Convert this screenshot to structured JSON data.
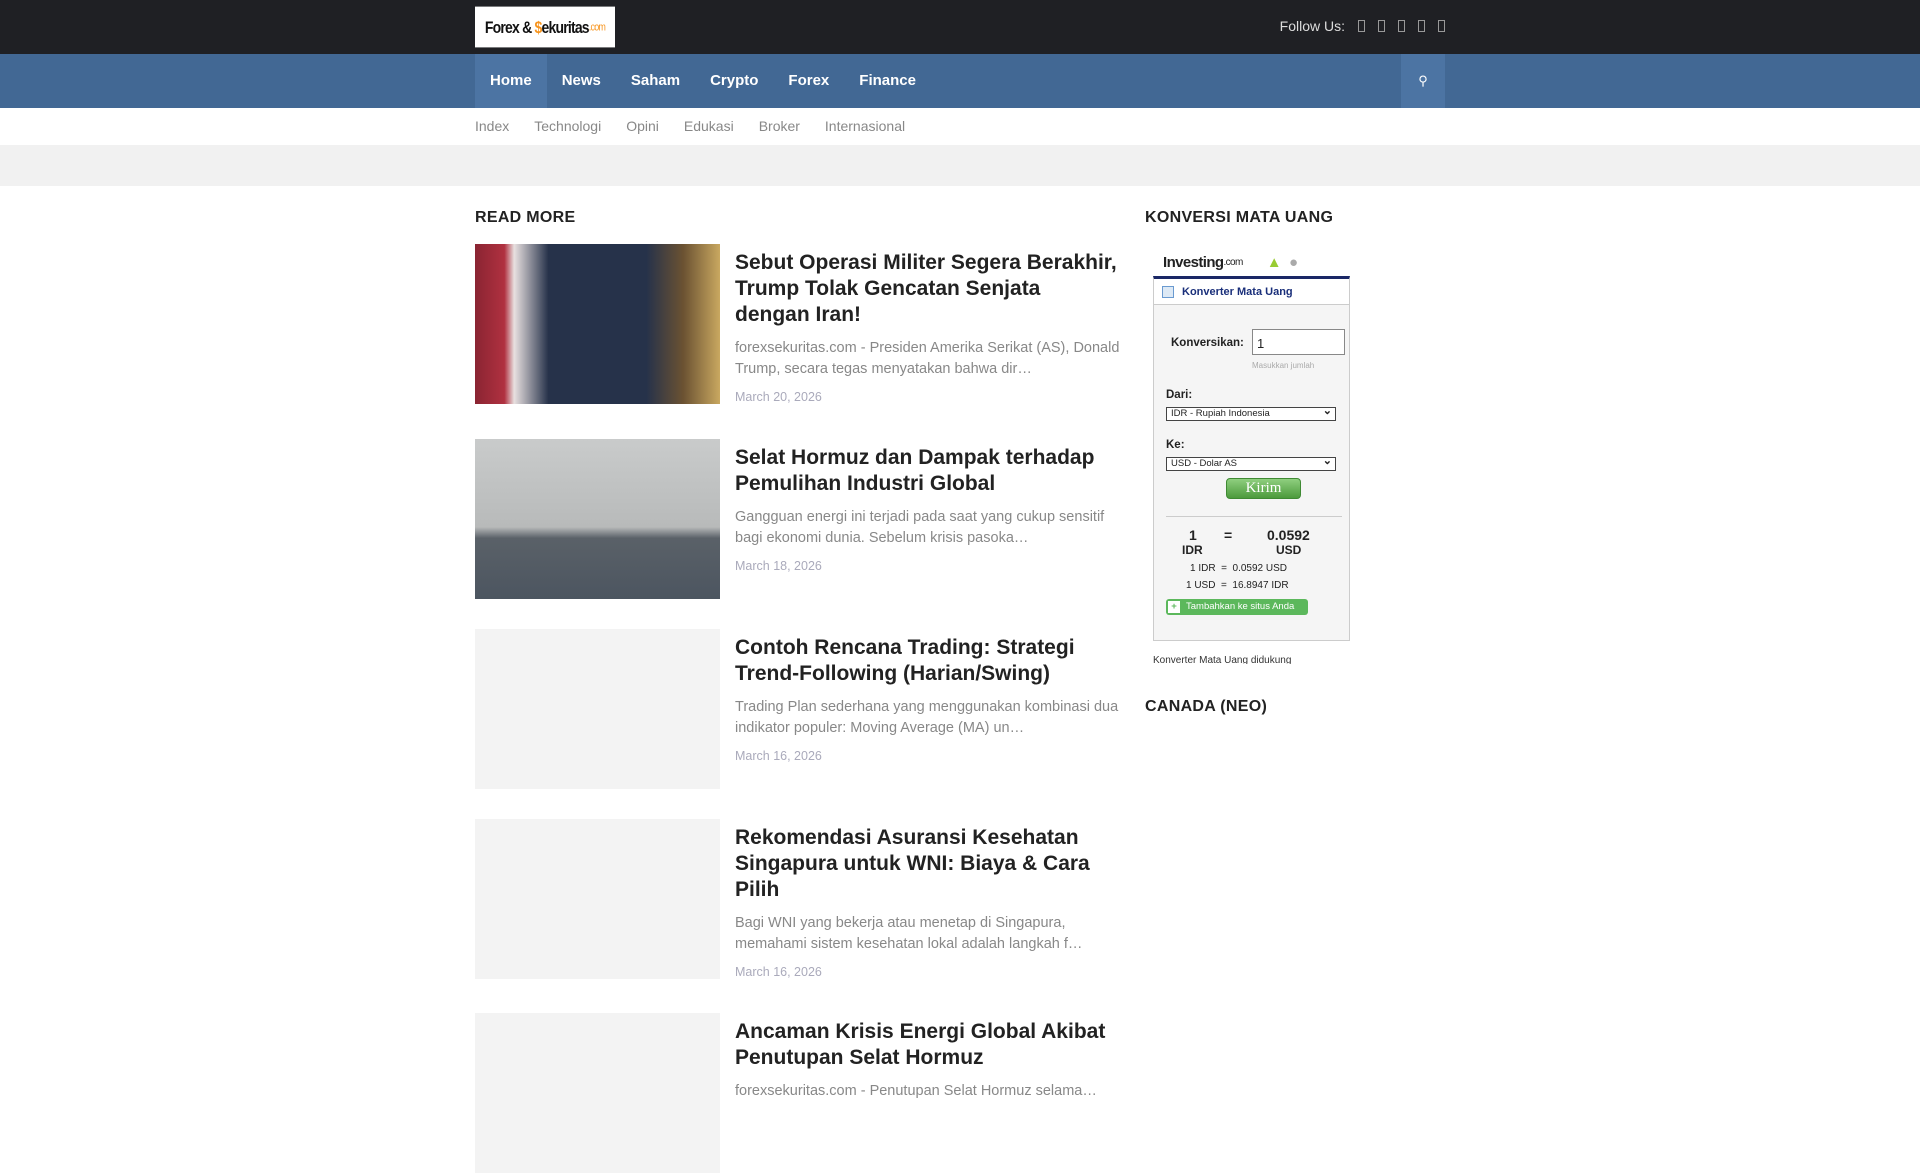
{
  "header": {
    "logo_text": "Forex & Sekuritas.com",
    "follow_label": "Follow Us:"
  },
  "nav": {
    "items": [
      "Home",
      "News",
      "Saham",
      "Crypto",
      "Forex",
      "Finance"
    ]
  },
  "subnav": {
    "items": [
      "Index",
      "Technologi",
      "Opini",
      "Edukasi",
      "Broker",
      "Internasional"
    ]
  },
  "main": {
    "heading": "READ MORE",
    "articles": [
      {
        "title": "Sebut Operasi Militer Segera Berakhir, Trump Tolak Gencatan Senjata dengan Iran!",
        "excerpt": "forexsekuritas.com - Presiden Amerika Serikat (AS), Donald Trump, secara tegas menyatakan bahwa dir…",
        "date": "March 20, 2026"
      },
      {
        "title": "Selat Hormuz dan Dampak terhadap Pemulihan Industri Global",
        "excerpt": "Gangguan energi ini terjadi pada saat yang cukup sensitif bagi ekonomi dunia. Sebelum krisis pasoka…",
        "date": "March 18, 2026"
      },
      {
        "title": "Contoh Rencana Trading: Strategi Trend-Following (Harian/Swing)",
        "excerpt": "Trading Plan sederhana yang menggunakan kombinasi dua indikator populer: Moving Average (MA) un…",
        "date": "March 16, 2026"
      },
      {
        "title": "Rekomendasi Asuransi Kesehatan Singapura untuk WNI: Biaya & Cara Pilih",
        "excerpt": "Bagi WNI yang bekerja atau menetap di Singapura, memahami sistem kesehatan lokal adalah langkah f…",
        "date": "March 16, 2026"
      },
      {
        "title": "Ancaman Krisis Energi Global Akibat Penutupan Selat Hormuz",
        "excerpt": "forexsekuritas.com - Penutupan Selat Hormuz selama…",
        "date": ""
      }
    ]
  },
  "sidebar": {
    "heading1": "KONVERSI MATA UANG",
    "heading2": "CANADA (NEO)",
    "widget": {
      "brand": "Investing",
      "brand_suffix": ".com",
      "title": "Konverter Mata Uang",
      "convert_label": "Konversikan:",
      "amount": "1",
      "amount_hint": "Masukkan jumlah",
      "from_label": "Dari:",
      "from_value": "IDR - Rupiah Indonesia",
      "to_label": "Ke:",
      "to_value": "USD - Dolar AS",
      "submit": "Kirim",
      "res_left_num": "1",
      "res_left_cur": "IDR",
      "equals": "=",
      "res_right_num": "0.0592",
      "res_right_cur": "USD",
      "rate1": "1 IDR  =  0.0592 USD",
      "rate2": "1 USD  =  16.8947 IDR",
      "add_button": "Tambahkan ke situs Anda",
      "footer": "Konverter Mata Uang didukung"
    }
  }
}
